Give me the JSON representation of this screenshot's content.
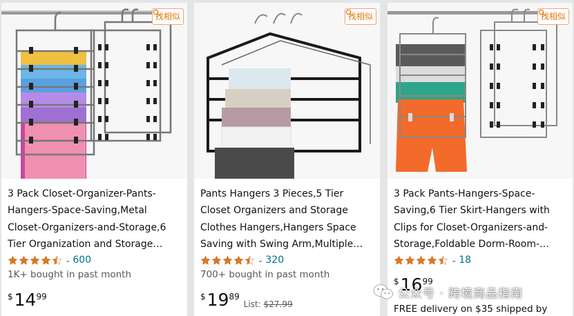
{
  "ui": {
    "find_similar_label": "找相似",
    "chevron": "⌄",
    "star_color": "#de7921",
    "link_color": "#007185"
  },
  "products": [
    {
      "title": "3 Pack Closet-Organizer-Pants-Hangers-Space-Saving,Metal Closet-Organizers-and-Storage,6 Tier Organization and Storage…",
      "rating": 4.5,
      "review_count": "600",
      "bought": "1K+ bought in past month",
      "price": {
        "symbol": "$",
        "whole": "14",
        "fraction": "99"
      }
    },
    {
      "title": "Pants Hangers 3 Pieces,5 Tier Closet Organizers and Storage Clothes Hangers,Hangers Space Saving with Swing Arm,Multiple…",
      "rating": 4.5,
      "review_count": "320",
      "bought": "700+ bought in past month",
      "price": {
        "symbol": "$",
        "whole": "19",
        "fraction": "89"
      },
      "list_price": {
        "label": "List:",
        "value": "$27.99"
      }
    },
    {
      "title": "3 Pack Pants-Hangers-Space-Saving,6 Tier Skirt-Hangers with Clips for Closet-Organizers-and-Storage,Foldable Dorm-Room-…",
      "rating": 4.5,
      "review_count": "18",
      "price": {
        "symbol": "$",
        "whole": "16",
        "fraction": "99"
      },
      "delivery": "FREE delivery on $35 shipped by"
    }
  ],
  "watermark": {
    "text": "公众号 · 跨境商品指南",
    "icon": "wechat-logo"
  }
}
